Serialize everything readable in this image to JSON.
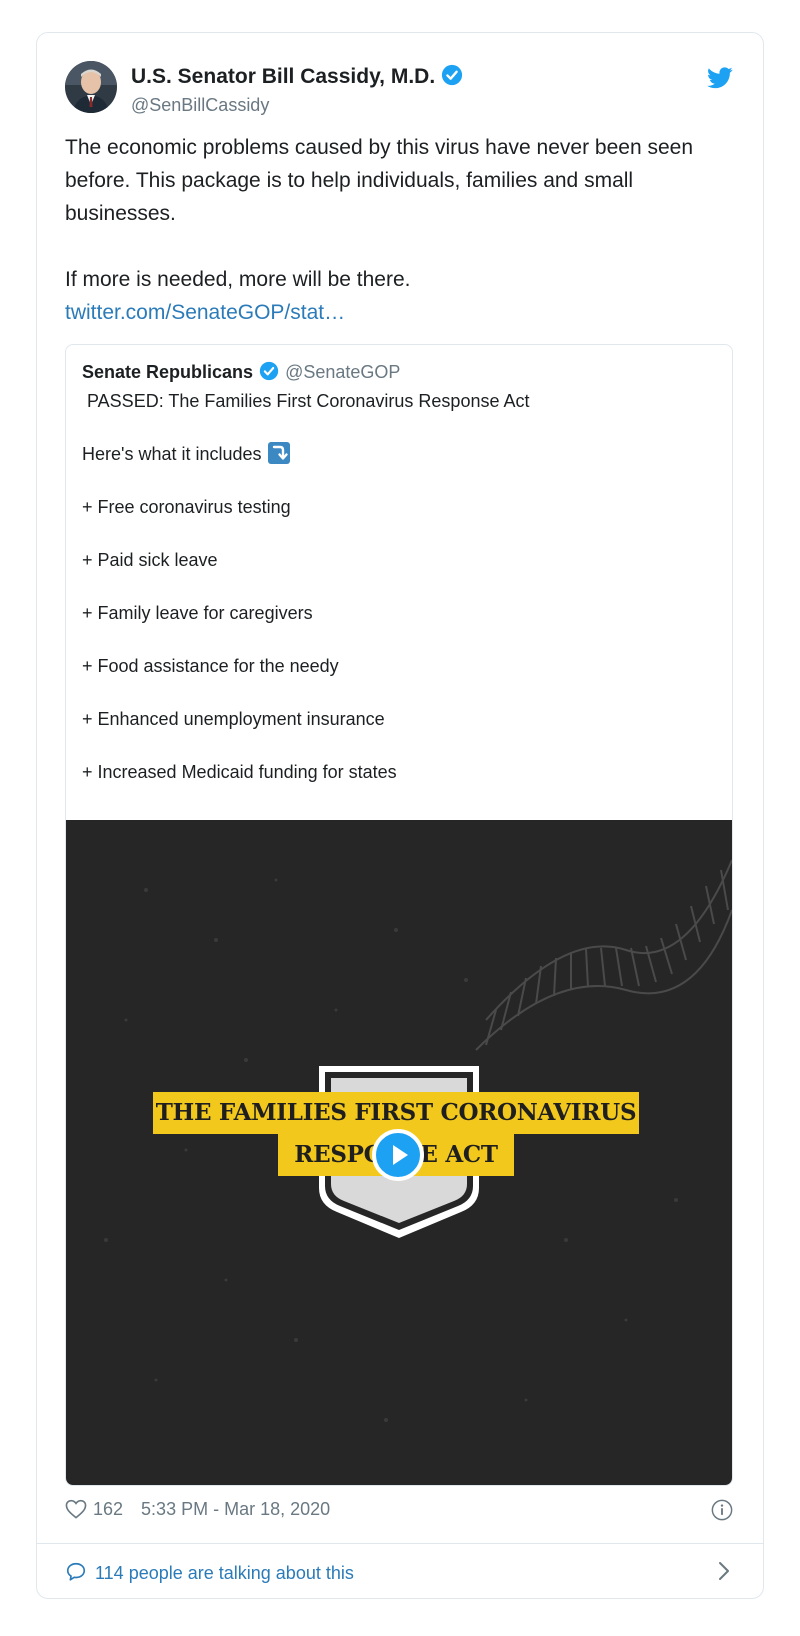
{
  "author": {
    "name": "U.S. Senator Bill Cassidy, M.D.",
    "handle": "@SenBillCassidy"
  },
  "tweet": {
    "paragraph1": "The economic problems caused by this virus have never been seen before. This package is to help individuals, families and small businesses.",
    "paragraph2": "If more is needed, more will be there.",
    "link": "twitter.com/SenateGOP/stat…"
  },
  "quoted": {
    "name": "Senate Republicans",
    "handle": "@SenateGOP",
    "lines": [
      "PASSED: The Families First Coronavirus Response Act",
      "Here's what it includes",
      "+ Free coronavirus testing",
      "+ Paid sick leave",
      "+ Family leave for caregivers",
      "+ Food assistance for the needy",
      "+ Enhanced unemployment insurance",
      "+ Increased Medicaid funding for states"
    ],
    "video": {
      "title_line1": "THE FAMILIES FIRST CORONAVIRUS",
      "title_line2": "RESPONSE ACT"
    }
  },
  "footer": {
    "likes": "162",
    "timestamp": "5:33 PM - Mar 18, 2020",
    "talking": "114 people are talking about this"
  },
  "colors": {
    "link": "#2b7bb9",
    "verified": "#1da1f2",
    "banner": "#f3c81c",
    "video_bg": "#262626"
  },
  "icons": [
    "verified-badge-icon",
    "twitter-bird-icon",
    "right-arrow-curving-down-icon",
    "play-icon",
    "heart-icon",
    "info-icon",
    "speech-bubble-icon",
    "chevron-right-icon"
  ]
}
